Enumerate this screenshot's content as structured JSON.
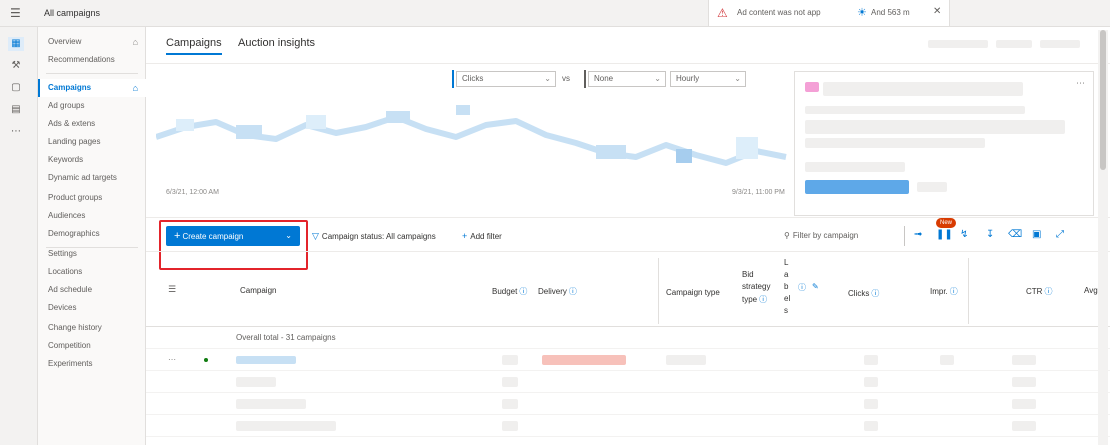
{
  "topbar": {
    "menu_icon": "hamburger-icon",
    "breadcrumb": "All campaigns",
    "notice": {
      "warning_text": "Ad content was not app",
      "bulb_text": "And 563 m",
      "close_icon": "close-icon"
    }
  },
  "sidenav": {
    "items": [
      {
        "label": "Overview",
        "icon": "home-icon"
      },
      {
        "label": "Recommendations",
        "icon": ""
      },
      {
        "label": "Campaigns",
        "icon": "home-icon",
        "active": true
      },
      {
        "label": "Ad groups",
        "icon": ""
      },
      {
        "label": "Ads & extens",
        "icon": ""
      },
      {
        "label": "Landing pages",
        "icon": ""
      },
      {
        "label": "Keywords",
        "icon": ""
      },
      {
        "label": "Dynamic ad targets",
        "icon": ""
      },
      {
        "label": "Product groups",
        "icon": ""
      },
      {
        "label": "Audiences",
        "icon": ""
      },
      {
        "label": "Demographics",
        "icon": ""
      },
      {
        "label": "Settings",
        "icon": ""
      },
      {
        "label": "Locations",
        "icon": ""
      },
      {
        "label": "Ad schedule",
        "icon": ""
      },
      {
        "label": "Devices",
        "icon": ""
      },
      {
        "label": "Change history",
        "icon": ""
      },
      {
        "label": "Competition",
        "icon": ""
      },
      {
        "label": "Experiments",
        "icon": ""
      }
    ]
  },
  "tabs": [
    {
      "label": "Campaigns",
      "active": true
    },
    {
      "label": "Auction insights",
      "active": false
    }
  ],
  "chart_controls": {
    "metric1": "Clicks",
    "vs": "vs",
    "metric2": "None",
    "interval": "Hourly",
    "metric1_color": "#0078d4",
    "metric2_color": "#8a8886"
  },
  "chart_dates": {
    "start": "6/3/21, 12:00 AM",
    "end": "9/3/21, 11:00 PM"
  },
  "toolbar": {
    "create_label": "Create campaign",
    "status_filter": "Campaign status: All campaigns",
    "add_filter": "Add filter",
    "filter_placeholder": "Filter by campaign",
    "new_badge": "New"
  },
  "grid": {
    "headers": {
      "campaign": "Campaign",
      "budget": "Budget",
      "delivery": "Delivery",
      "campaign_type": "Campaign type",
      "bid_strategy": [
        "Bid",
        "strategy",
        "type"
      ],
      "labels": [
        "L",
        "a",
        "b",
        "el",
        "s"
      ],
      "clicks": "Clicks",
      "impr": "Impr.",
      "ctr": "CTR",
      "avg": "Avg"
    },
    "overall_total": "Overall total - 31 campaigns"
  },
  "colors": {
    "accent": "#0078d4",
    "highlight": "#e3242b",
    "new_badge": "#d83b01"
  }
}
